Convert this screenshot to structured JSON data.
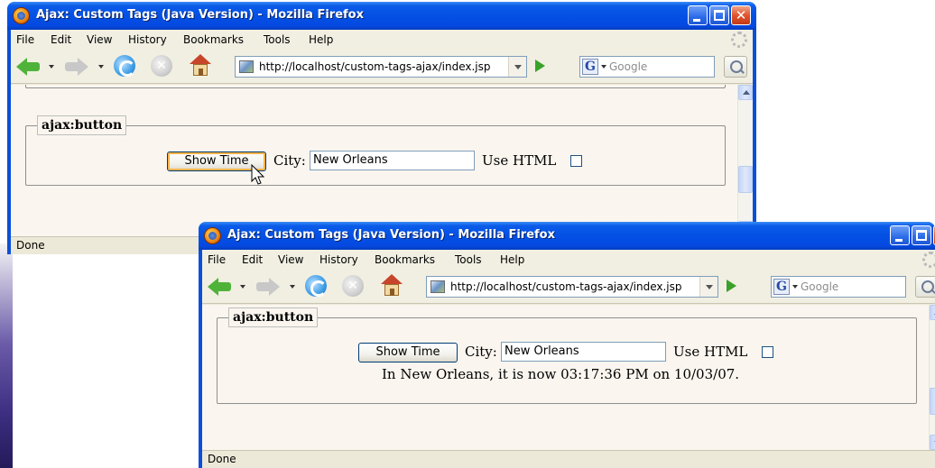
{
  "browser": {
    "title": "Ajax: Custom Tags (Java Version) - Mozilla Firefox",
    "menu": [
      "File",
      "Edit",
      "View",
      "History",
      "Bookmarks",
      "Tools",
      "Help"
    ],
    "url": "http://localhost/custom-tags-ajax/index.jsp",
    "search_placeholder": "Google",
    "search_engine_logo": "G",
    "status": "Done"
  },
  "page": {
    "legend": "ajax:button",
    "show_time_label": "Show Time",
    "city_label": "City:",
    "city_value": "New Orleans",
    "use_html_label": "Use HTML",
    "use_html_checked": false
  },
  "after": {
    "result_text": "In New Orleans, it is now 03:17:36 PM on 10/03/07."
  },
  "icons": [
    "firefox-logo-icon",
    "minimize-icon",
    "maximize-icon",
    "close-icon",
    "back-arrow-icon",
    "forward-arrow-icon",
    "reload-icon",
    "stop-icon",
    "home-icon",
    "page-favicon-icon",
    "go-arrow-icon",
    "search-magnifier-icon",
    "mouse-cursor-icon"
  ],
  "colors": {
    "titlebar": "#0450e4",
    "close_button": "#e0552e",
    "page_background": "#faf6ef",
    "chrome": "#ece9d8"
  }
}
